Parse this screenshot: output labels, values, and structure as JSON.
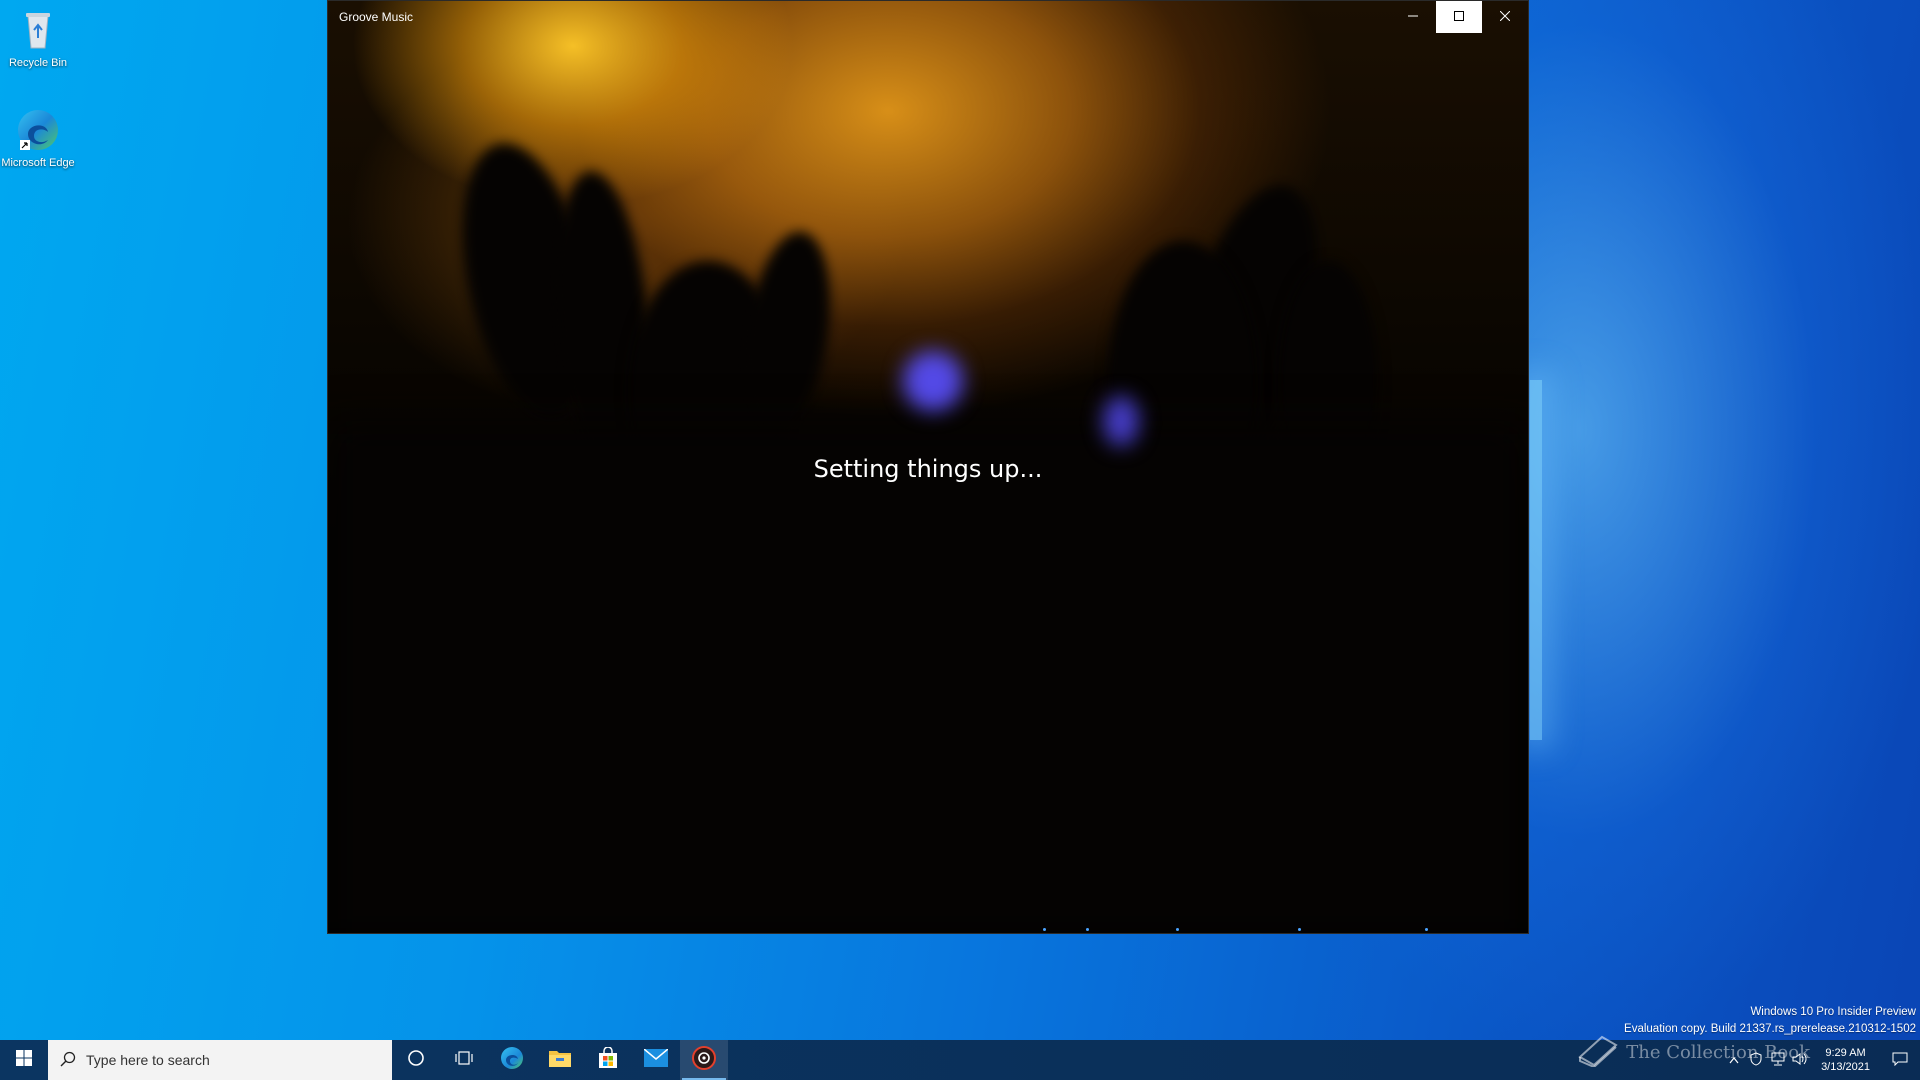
{
  "desktop": {
    "icons": [
      {
        "label": "Recycle Bin",
        "icon": "recycle-bin-icon"
      },
      {
        "label": "Microsoft Edge",
        "icon": "edge-icon"
      }
    ],
    "watermark": {
      "line1": "Windows 10 Pro Insider Preview",
      "line2": "Evaluation copy. Build 21337.rs_prerelease.210312-1502"
    },
    "brand_watermark": "The Collection Book"
  },
  "window": {
    "title": "Groove Music",
    "status": "Setting things up...",
    "controls": {
      "minimize": "–",
      "maximize": "☐",
      "close": "✕"
    }
  },
  "taskbar": {
    "search_placeholder": "Type here to search",
    "pinned": [
      "cortana-icon",
      "task-view-icon",
      "edge-icon",
      "file-explorer-icon",
      "store-icon",
      "mail-icon",
      "groove-music-icon"
    ],
    "active_app": "groove-music-icon",
    "clock": {
      "time": "9:29 AM",
      "date": "3/13/2021"
    }
  },
  "colors": {
    "desktop_blue": "#0593ea",
    "taskbar": "#0b3561",
    "accent": "#76b9ed",
    "window_bg": "#000000"
  }
}
